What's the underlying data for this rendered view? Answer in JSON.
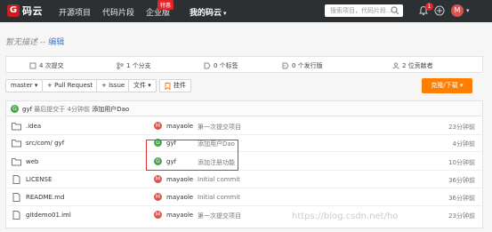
{
  "nav": {
    "logo_mark": "G",
    "logo_text": "码云",
    "items": [
      {
        "label": "开源项目"
      },
      {
        "label": "代码片段"
      },
      {
        "label": "企业版"
      },
      {
        "label": "我的码云"
      }
    ],
    "hot_badge": "特惠",
    "caret": "▾",
    "search_placeholder": "搜索项目，代码片段...",
    "notif_count": "1",
    "avatar_letter": "M"
  },
  "description": {
    "text": "暂无描述",
    "separator": " -- ",
    "edit_label": "编辑"
  },
  "stats": [
    {
      "value": "4 次提交",
      "icon": "commit-icon"
    },
    {
      "value": "1 个分支",
      "icon": "branch-icon"
    },
    {
      "value": "0 个标签",
      "icon": "tag-icon"
    },
    {
      "value": "0 个发行版",
      "icon": "release-icon"
    },
    {
      "value": "2 位贡献者",
      "icon": "contributors-icon"
    }
  ],
  "toolbar": {
    "branch": "master ▾",
    "pull_request": "+ Pull Request",
    "issue": "+ Issue",
    "file_menu": "文件 ▾",
    "pendant": "挂件",
    "clone": "克隆/下载 ▾"
  },
  "latest_commit": {
    "avatar": "G",
    "author": "gyf",
    "meta": "最后提交于 4分钟前",
    "message": "添加用户Dao"
  },
  "files": [
    {
      "name": ".idea",
      "type": "folder",
      "author": "mayaole",
      "avatar": "M",
      "avatar_color": "#d9534f",
      "message": "第一次提交项目",
      "time": "23分钟前"
    },
    {
      "name": "src/com/ gyf",
      "type": "folder",
      "author": "gyf",
      "avatar": "G",
      "avatar_color": "#4aa351",
      "message": "添加用户Dao",
      "time": "4分钟前"
    },
    {
      "name": "web",
      "type": "folder",
      "author": "gyf",
      "avatar": "G",
      "avatar_color": "#4aa351",
      "message": "添加注册功能",
      "time": "10分钟前"
    },
    {
      "name": "LICENSE",
      "type": "file",
      "author": "mayaole",
      "avatar": "M",
      "avatar_color": "#d9534f",
      "message": "Initial commit",
      "time": "36分钟前"
    },
    {
      "name": "README.md",
      "type": "file",
      "author": "mayaole",
      "avatar": "M",
      "avatar_color": "#d9534f",
      "message": "Initial commit",
      "time": "36分钟前"
    },
    {
      "name": "gitdemo01.iml",
      "type": "file",
      "author": "mayaole",
      "avatar": "M",
      "avatar_color": "#d9534f",
      "message": "第一次提交项目",
      "time": "23分钟前"
    }
  ],
  "watermark": "https://blog.csdn.net/ho",
  "colors": {
    "accent": "#ff7d00",
    "brand": "#c71d23",
    "highlight": "#e03030"
  }
}
